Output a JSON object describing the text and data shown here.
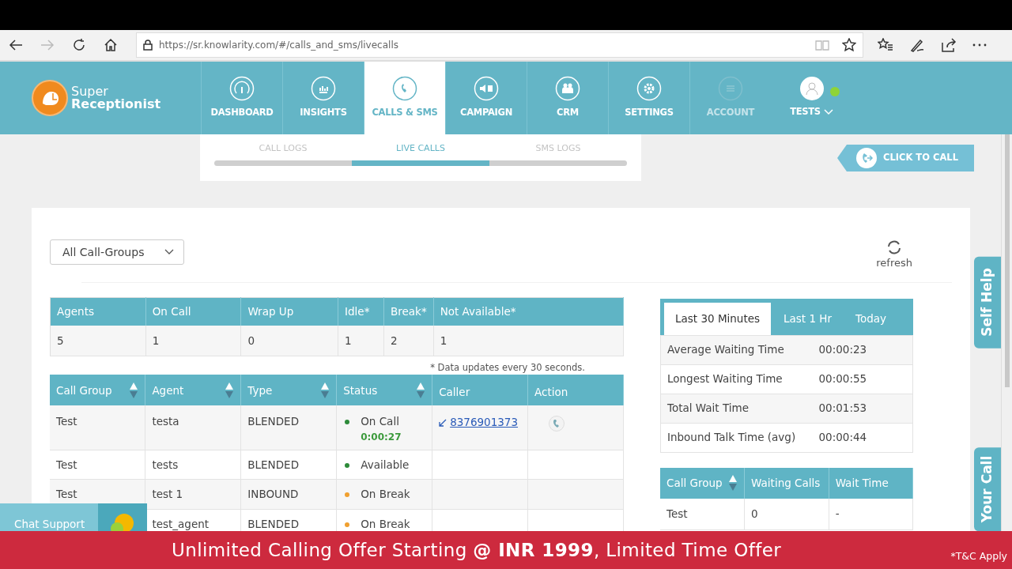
{
  "browser": {
    "url": "https://sr.knowlarity.com/#/calls_and_sms/livecalls",
    "forward_disabled": true
  },
  "app": {
    "logo": [
      "Super",
      "Receptionist"
    ],
    "nav": [
      {
        "label": "DASHBOARD",
        "kind": "gauge",
        "selected": false,
        "disabled": false
      },
      {
        "label": "INSIGHTS",
        "kind": "chart",
        "selected": false,
        "disabled": false
      },
      {
        "label": "CALLS & SMS",
        "kind": "phone",
        "selected": true,
        "disabled": false
      },
      {
        "label": "CAMPAIGN",
        "kind": "megaphone",
        "selected": false,
        "disabled": false
      },
      {
        "label": "CRM",
        "kind": "people",
        "selected": false,
        "disabled": false
      },
      {
        "label": "SETTINGS",
        "kind": "gear",
        "selected": false,
        "disabled": false
      },
      {
        "label": "ACCOUNT",
        "kind": "list",
        "selected": false,
        "disabled": true
      }
    ],
    "user": {
      "name": "TESTS",
      "online": true
    }
  },
  "subtabs": [
    {
      "label": "CALL LOGS",
      "selected": false
    },
    {
      "label": "LIVE CALLS",
      "selected": true
    },
    {
      "label": "SMS LOGS",
      "selected": false
    }
  ],
  "click_to_call": "CLICK TO CALL",
  "filter": "All Call-Groups",
  "refresh": "refresh",
  "summary": {
    "columns": [
      "Agents",
      "On Call",
      "Wrap Up",
      "Idle*",
      "Break*",
      "Not Available*"
    ],
    "values": [
      "5",
      "1",
      "0",
      "1",
      "2",
      "1"
    ]
  },
  "note": "* Data updates every 30 seconds.",
  "agents": {
    "columns": [
      {
        "label": "Call Group",
        "sortable": true
      },
      {
        "label": "Agent",
        "sortable": true
      },
      {
        "label": "Type",
        "sortable": true
      },
      {
        "label": "Status",
        "sortable": true
      },
      {
        "label": "Caller",
        "sortable": false
      },
      {
        "label": "Action",
        "sortable": false
      }
    ],
    "rows": [
      {
        "call_group": "Test",
        "agent": "testa",
        "type": "BLENDED",
        "status": "On Call",
        "color": "#2e8b3a",
        "timer": "0:00:27",
        "caller": "8376901373",
        "can_call": true
      },
      {
        "call_group": "Test",
        "agent": "tests",
        "type": "BLENDED",
        "status": "Available",
        "color": "#2e8b3a",
        "can_call": false
      },
      {
        "call_group": "Test",
        "agent": "test 1",
        "type": "INBOUND",
        "status": "On Break",
        "color": "#f0a030",
        "can_call": false
      },
      {
        "agent": "test_agent",
        "type": "BLENDED",
        "status": "On Break",
        "color": "#f0a030",
        "can_call": false
      }
    ]
  },
  "stats": {
    "tabs": [
      {
        "label": "Last 30 Minutes",
        "selected": true
      },
      {
        "label": "Last 1 Hr",
        "selected": false
      },
      {
        "label": "Today",
        "selected": false
      }
    ],
    "rows": [
      {
        "label": "Average Waiting Time",
        "value": "00:00:23"
      },
      {
        "label": "Longest Waiting Time",
        "value": "00:00:55"
      },
      {
        "label": "Total Wait Time",
        "value": "00:01:53"
      },
      {
        "label": "Inbound Talk Time (avg)",
        "value": "00:00:44"
      }
    ]
  },
  "waiting": {
    "columns": [
      {
        "label": "Call Group",
        "sortable": true
      },
      {
        "label": "Waiting Calls",
        "sortable": false
      },
      {
        "label": "Wait Time",
        "sortable": false
      }
    ],
    "rows": [
      [
        "Test",
        "0",
        "-"
      ]
    ]
  },
  "side_tabs": [
    "Self Help",
    "Your Call"
  ],
  "chat": "Chat Support",
  "banner": {
    "text": "Unlimited Calling Offer Starting **@ INR 1999**, Limited Time Offer",
    "note": "*T&C Apply"
  }
}
